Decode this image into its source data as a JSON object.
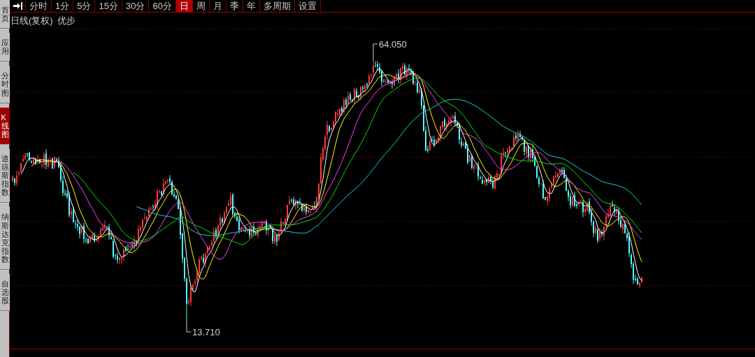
{
  "toolbar": {
    "items": [
      {
        "label": "分时",
        "selected": false
      },
      {
        "label": "1分",
        "selected": false
      },
      {
        "label": "5分",
        "selected": false
      },
      {
        "label": "15分",
        "selected": false
      },
      {
        "label": "30分",
        "selected": false
      },
      {
        "label": "60分",
        "selected": false
      },
      {
        "label": "日",
        "selected": true
      },
      {
        "label": "周",
        "selected": false
      },
      {
        "label": "月",
        "selected": false
      },
      {
        "label": "季",
        "selected": false
      },
      {
        "label": "年",
        "selected": false
      },
      {
        "label": "多周期",
        "selected": false
      },
      {
        "label": "设置",
        "selected": false
      }
    ]
  },
  "sidebar": {
    "tabs": [
      {
        "label": "首页",
        "selected": false
      },
      {
        "label": "应用",
        "selected": false
      },
      {
        "label": "分时图",
        "selected": false
      },
      {
        "label": "K线图",
        "selected": true
      },
      {
        "label": "道琼斯指数",
        "selected": false
      },
      {
        "label": "纳斯达克指数",
        "selected": false
      },
      {
        "label": "自选股",
        "selected": false
      }
    ]
  },
  "chart": {
    "period": "日线(复权)",
    "symbol": "优步",
    "high_label": "64.050",
    "low_label": "13.710"
  }
}
